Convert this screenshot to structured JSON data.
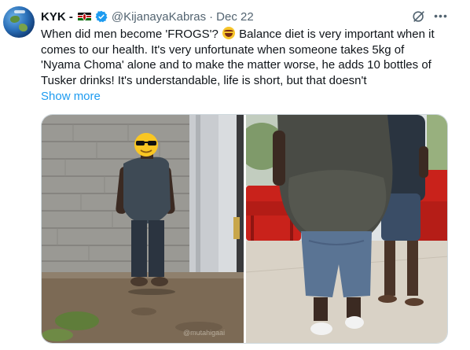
{
  "author": {
    "name": "KYK -",
    "handle": "@KijanayaKabras",
    "separator": "·",
    "date": "Dec 22",
    "flag_icon": "kenya-flag-icon",
    "verified_icon": "verified-badge-icon",
    "verified_color": "#1d9bf0"
  },
  "tweet": {
    "lines": [
      {
        "before": "When did men become 'FROGS'? ",
        "emoji": "laughing-face-emoji",
        "after": " Balance diet is very important when it"
      },
      {
        "text": "comes to our health. It's very unfortunate when someone takes 5kg of"
      },
      {
        "text": "'Nyama Choma' alone and to make the matter worse, he adds 10 bottles of"
      },
      {
        "text": "Tusker drinks! It's understandable, life is short, but that doesn't"
      }
    ],
    "show_more": "Show more"
  },
  "media": {
    "photos": [
      {
        "subject": "man-standing-by-stone-wall",
        "overlay_emoji": "sunglasses-face-emoji",
        "watermark": "@mutahigaai"
      },
      {
        "subject": "man-with-large-belly-rear-view"
      }
    ]
  },
  "colors": {
    "link": "#1d9bf0",
    "text": "#0f1419",
    "secondary": "#536471",
    "border": "#cfd9de"
  },
  "icons": {
    "grok": "grok-icon",
    "more": "more-options-icon"
  }
}
